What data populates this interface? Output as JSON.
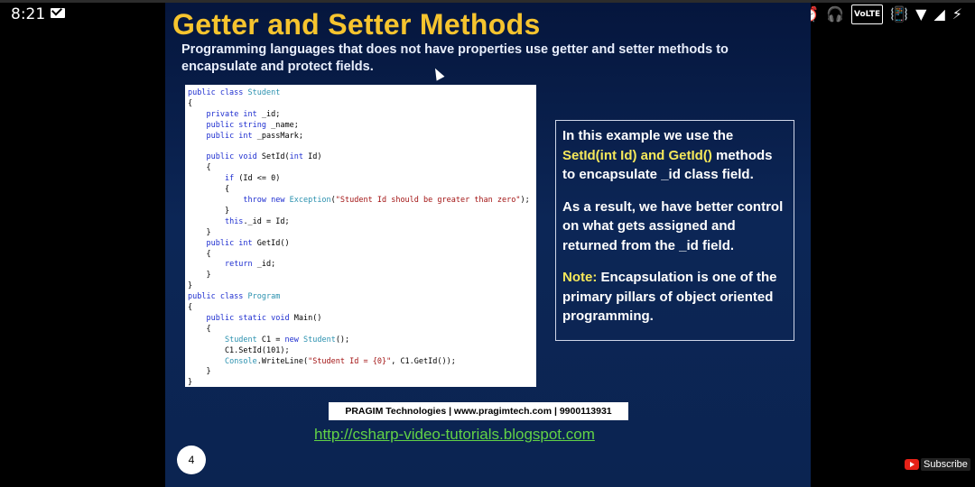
{
  "status_bar": {
    "time": "8:21",
    "volte": "VoLTE",
    "icons": [
      "mail-icon",
      "alarm-icon",
      "headphones-icon",
      "vibrate-icon",
      "wifi-icon",
      "signal-icon",
      "battery-charging-icon"
    ]
  },
  "slide": {
    "title": "Getter and Setter Methods",
    "subtitle": "Programming languages that does not have properties use getter and setter methods to encapsulate and protect fields.",
    "code_lines": [
      [
        [
          "kw",
          "public class "
        ],
        [
          "ty",
          "Student"
        ]
      ],
      [
        [
          "",
          "{"
        ]
      ],
      [
        [
          "",
          "    "
        ],
        [
          "kw",
          "private int "
        ],
        [
          "",
          "_id;"
        ]
      ],
      [
        [
          "",
          "    "
        ],
        [
          "kw",
          "public string "
        ],
        [
          "",
          "_name;"
        ]
      ],
      [
        [
          "",
          "    "
        ],
        [
          "kw",
          "public int "
        ],
        [
          "",
          "_passMark;"
        ]
      ],
      [
        [
          "",
          ""
        ]
      ],
      [
        [
          "",
          "    "
        ],
        [
          "kw",
          "public void "
        ],
        [
          "",
          "SetId("
        ],
        [
          "kw",
          "int "
        ],
        [
          "",
          "Id)"
        ]
      ],
      [
        [
          "",
          "    {"
        ]
      ],
      [
        [
          "",
          "        "
        ],
        [
          "kw",
          "if "
        ],
        [
          "",
          "(Id <= 0)"
        ]
      ],
      [
        [
          "",
          "        {"
        ]
      ],
      [
        [
          "",
          "            "
        ],
        [
          "kw",
          "throw new "
        ],
        [
          "ty",
          "Exception"
        ],
        [
          "",
          "("
        ],
        [
          "st",
          "\"Student Id should be greater than zero\""
        ],
        [
          "",
          ");"
        ]
      ],
      [
        [
          "",
          "        }"
        ]
      ],
      [
        [
          "",
          "        "
        ],
        [
          "kw",
          "this"
        ],
        [
          "",
          "._id = Id;"
        ]
      ],
      [
        [
          "",
          "    }"
        ]
      ],
      [
        [
          "",
          "    "
        ],
        [
          "kw",
          "public int "
        ],
        [
          "",
          "GetId()"
        ]
      ],
      [
        [
          "",
          "    {"
        ]
      ],
      [
        [
          "",
          "        "
        ],
        [
          "kw",
          "return "
        ],
        [
          "",
          "_id;"
        ]
      ],
      [
        [
          "",
          "    }"
        ]
      ],
      [
        [
          "",
          "}"
        ]
      ],
      [
        [
          "kw",
          "public class "
        ],
        [
          "ty",
          "Program"
        ]
      ],
      [
        [
          "",
          "{"
        ]
      ],
      [
        [
          "",
          "    "
        ],
        [
          "kw",
          "public static void "
        ],
        [
          "",
          "Main()"
        ]
      ],
      [
        [
          "",
          "    {"
        ]
      ],
      [
        [
          "",
          "        "
        ],
        [
          "ty",
          "Student "
        ],
        [
          "",
          "C1 = "
        ],
        [
          "kw",
          "new "
        ],
        [
          "ty",
          "Student"
        ],
        [
          "",
          "();"
        ]
      ],
      [
        [
          "",
          "        C1.SetId(101);"
        ]
      ],
      [
        [
          "",
          "        "
        ],
        [
          "ty",
          "Console"
        ],
        [
          "",
          ".WriteLine("
        ],
        [
          "st",
          "\"Student Id = {0}\""
        ],
        [
          "",
          ", C1.GetId());"
        ]
      ],
      [
        [
          "",
          "    }"
        ]
      ],
      [
        [
          "",
          "}"
        ]
      ]
    ],
    "info": {
      "p1_a": "In this example we use the ",
      "p1_hl": "SetId(int Id) and GetId()",
      "p1_b": " methods to encapsulate _id class field.",
      "p2": "As a result, we have better control on what gets assigned and returned from the _id field.",
      "p3_label": "Note:",
      "p3_text": " Encapsulation is one of the primary pillars of object oriented programming."
    },
    "footer": "PRAGIM Technologies | www.pragimtech.com | 9900113931",
    "url": "http://csharp-video-tutorials.blogspot.com",
    "page_number": "4"
  },
  "overlay": {
    "subscribe_label": "Subscribe"
  },
  "colors": {
    "title": "#f6c42e",
    "highlight": "#f6e85a",
    "url": "#62d246",
    "slide_bg": "#0c2656"
  }
}
